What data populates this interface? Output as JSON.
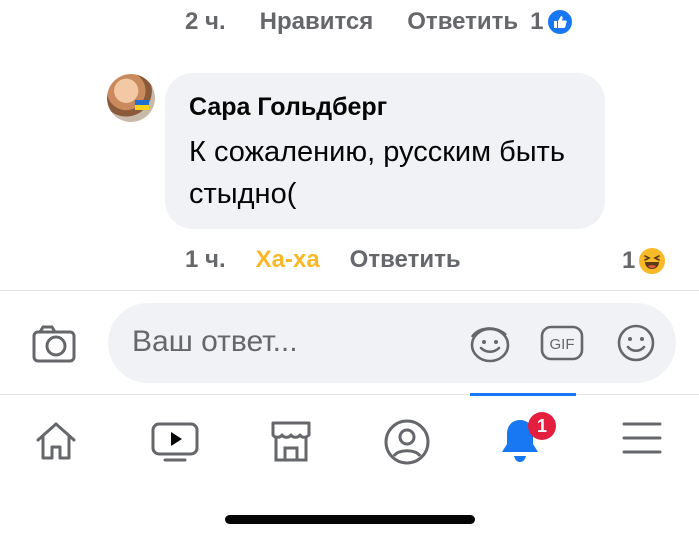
{
  "previous_comment": {
    "time": "2 ч.",
    "like_label": "Нравится",
    "reply_label": "Ответить",
    "reaction_count": "1",
    "reaction_icon": "like-reaction-icon"
  },
  "comment": {
    "author": "Сара Гольдберг",
    "text": "К сожалению, русским быть стыдно(",
    "time": "1 ч.",
    "reaction_label": "Ха-ха",
    "reply_label": "Ответить",
    "reaction_count": "1",
    "reaction_icon": "haha-reaction-icon"
  },
  "reply_box": {
    "placeholder": "Ваш ответ...",
    "gif_label": "GIF"
  },
  "nav": {
    "items": [
      "home",
      "watch",
      "marketplace",
      "profile",
      "notifications",
      "menu"
    ],
    "active": "notifications",
    "notification_badge": "1"
  },
  "colors": {
    "accent": "#1877f2",
    "haha": "#f7b928",
    "badge": "#e41e3f",
    "bubble": "#f0f2f5",
    "meta": "#65676b"
  }
}
